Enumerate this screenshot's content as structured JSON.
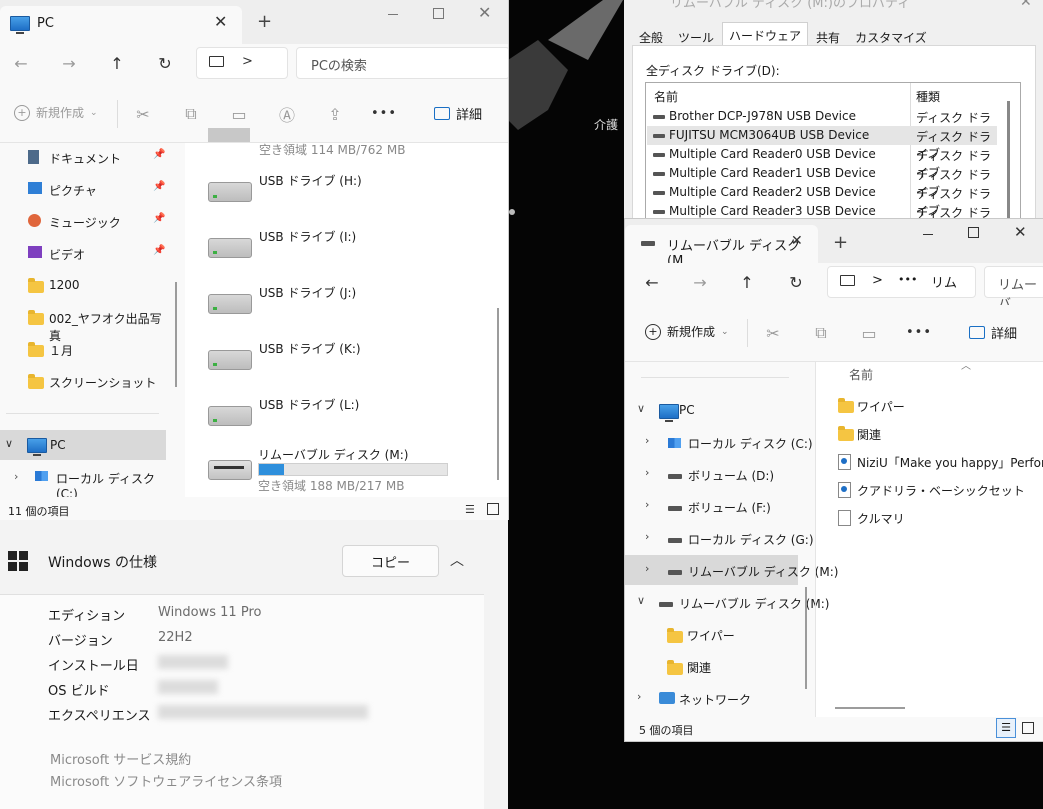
{
  "win1": {
    "tab_title": "PC",
    "new_tab": "+",
    "breadcrumb_sep": ">",
    "search_placeholder": "PCの検索",
    "new_label": "新規作成",
    "more": "•••",
    "details_label": "詳細",
    "nav": [
      {
        "label": "ドキュメント",
        "pinned": true,
        "icon": "document-icon"
      },
      {
        "label": "ピクチャ",
        "pinned": true,
        "icon": "pictures-icon"
      },
      {
        "label": "ミュージック",
        "pinned": true,
        "icon": "music-icon"
      },
      {
        "label": "ビデオ",
        "pinned": true,
        "icon": "video-icon"
      },
      {
        "label": "1200",
        "pinned": false,
        "icon": "folder-icon"
      },
      {
        "label": "002_ヤフオク出品写真",
        "pinned": false,
        "icon": "folder-icon"
      },
      {
        "label": "１月",
        "pinned": false,
        "icon": "folder-icon"
      },
      {
        "label": "スクリーンショット",
        "pinned": false,
        "icon": "folder-icon"
      }
    ],
    "pc_label": "PC",
    "local_disk_c": "ローカル ディスク (C:)",
    "top_partial_free": "空き領域 114 MB/762 MB",
    "drives": [
      {
        "label": "USB ドライブ (H:)"
      },
      {
        "label": "USB ドライブ (I:)"
      },
      {
        "label": "USB ドライブ (J:)"
      },
      {
        "label": "USB ドライブ (K:)"
      },
      {
        "label": "USB ドライブ (L:)"
      }
    ],
    "removable": {
      "label": "リムーバブル ディスク (M:)",
      "free": "空き領域 188 MB/217 MB",
      "used_fraction": 0.134
    },
    "status": "11 個の項目"
  },
  "settings": {
    "section_title": "Windows の仕様",
    "copy_button": "コピー",
    "specs": [
      {
        "key": "エディション",
        "value": "Windows 11 Pro"
      },
      {
        "key": "バージョン",
        "value": "22H2"
      },
      {
        "key": "インストール日",
        "value": ""
      },
      {
        "key": "OS ビルド",
        "value": ""
      },
      {
        "key": "エクスペリエンス",
        "value": ""
      }
    ],
    "links": [
      "Microsoft サービス規約",
      "Microsoft ソフトウェアライセンス条項"
    ]
  },
  "props": {
    "title": "リムーバブル ディスク (M:)のプロパティ",
    "tabs": [
      "全般",
      "ツール",
      "ハードウェア",
      "共有",
      "カスタマイズ"
    ],
    "active_tab": 2,
    "list_label": "全ディスク ドライブ(D):",
    "col_name": "名前",
    "col_type": "種類",
    "rows": [
      {
        "name": "Brother DCP-J978N USB Device",
        "type": "ディスク ドライブ"
      },
      {
        "name": "FUJITSU MCM3064UB USB Device",
        "type": "ディスク ドライブ"
      },
      {
        "name": "Multiple Card Reader0 USB Device",
        "type": "ディスク ドライブ"
      },
      {
        "name": "Multiple Card Reader1 USB Device",
        "type": "ディスク ドライブ"
      },
      {
        "name": "Multiple Card Reader2 USB Device",
        "type": "ディスク ドライブ"
      },
      {
        "name": "Multiple Card Reader3 USB Device",
        "type": "ディスク ドライブ"
      }
    ],
    "selected_row": 1
  },
  "bg_text": "介護",
  "win2": {
    "tab_title": "リムーバブル ディスク (M",
    "new_tab": "+",
    "crumb_sep": ">",
    "crumb_more": "•••",
    "crumb_item": "リム",
    "search_placeholder": "リムーバ",
    "new_label": "新規作成",
    "more": "•••",
    "details_label": "詳細",
    "tree": [
      {
        "label": "PC",
        "level": 0,
        "expanded": true,
        "icon": "pc-icon"
      },
      {
        "label": "ローカル ディスク (C:)",
        "level": 1,
        "expanded": false,
        "icon": "windows-drive-icon"
      },
      {
        "label": "ボリューム (D:)",
        "level": 1,
        "expanded": false,
        "icon": "drive-icon"
      },
      {
        "label": "ボリューム (F:)",
        "level": 1,
        "expanded": false,
        "icon": "drive-icon"
      },
      {
        "label": "ローカル ディスク (G:)",
        "level": 1,
        "expanded": false,
        "icon": "drive-icon"
      },
      {
        "label": "リムーバブル ディスク (M:)",
        "level": 1,
        "expanded": false,
        "icon": "drive-icon",
        "selected": true
      },
      {
        "label": "リムーバブル ディスク (M:)",
        "level": 0,
        "expanded": true,
        "icon": "drive-icon"
      },
      {
        "label": "ワイパー",
        "level": 1,
        "icon": "folder-icon"
      },
      {
        "label": "関連",
        "level": 1,
        "icon": "folder-icon"
      },
      {
        "label": "ネットワーク",
        "level": 0,
        "expanded": false,
        "icon": "network-icon"
      }
    ],
    "col_name": "名前",
    "files": [
      {
        "label": "ワイパー",
        "icon": "folder-icon"
      },
      {
        "label": "関連",
        "icon": "folder-icon"
      },
      {
        "label": "NiziU「Make you happy」Performan",
        "icon": "html-file-icon"
      },
      {
        "label": "クアドリラ・ベーシックセット",
        "icon": "html-file-icon"
      },
      {
        "label": "クルマリ",
        "icon": "text-file-icon"
      }
    ],
    "status": "5 個の項目"
  }
}
